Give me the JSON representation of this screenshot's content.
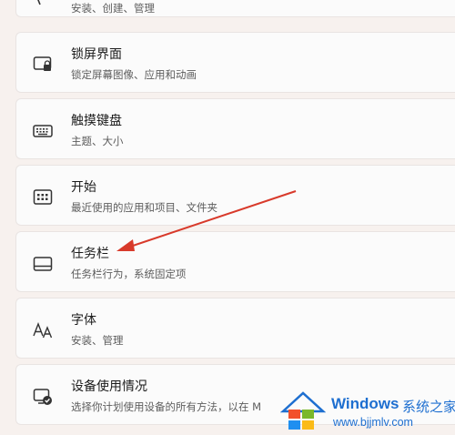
{
  "settings": {
    "items": [
      {
        "title": "",
        "subtitle": "安装、创建、管理",
        "icon": "app-icon"
      },
      {
        "title": "锁屏界面",
        "subtitle": "锁定屏幕图像、应用和动画",
        "icon": "lock-screen-icon"
      },
      {
        "title": "触摸键盘",
        "subtitle": "主题、大小",
        "icon": "keyboard-icon"
      },
      {
        "title": "开始",
        "subtitle": "最近使用的应用和项目、文件夹",
        "icon": "start-menu-icon"
      },
      {
        "title": "任务栏",
        "subtitle": "任务栏行为，系统固定项",
        "icon": "taskbar-icon"
      },
      {
        "title": "字体",
        "subtitle": "安装、管理",
        "icon": "font-icon"
      },
      {
        "title": "设备使用情况",
        "subtitle": "选择你计划使用设备的所有方法，以在 M",
        "icon": "device-usage-icon"
      }
    ]
  },
  "annotation": {
    "color": "#d83a2b",
    "icon": "red-arrow-icon"
  },
  "watermark": {
    "brand": "Windows",
    "brand_suffix": "系统之家",
    "url": "www.bjjmlv.com",
    "icon": "windows-flag-logo-icon"
  }
}
